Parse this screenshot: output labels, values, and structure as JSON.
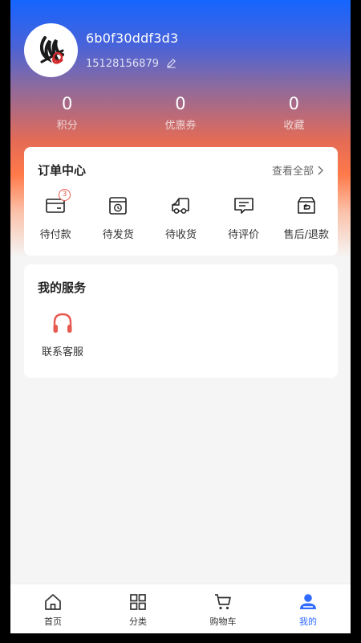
{
  "profile": {
    "username": "6b0f30ddf3d3",
    "phone": "15128156879"
  },
  "stats": [
    {
      "value": "0",
      "label": "积分"
    },
    {
      "value": "0",
      "label": "优惠券"
    },
    {
      "value": "0",
      "label": "收藏"
    }
  ],
  "orders": {
    "title": "订单中心",
    "view_all": "查看全部",
    "items": [
      {
        "label": "待付款",
        "icon": "wallet-icon",
        "badge": "3"
      },
      {
        "label": "待发货",
        "icon": "package-icon"
      },
      {
        "label": "待收货",
        "icon": "truck-icon"
      },
      {
        "label": "待评价",
        "icon": "comment-icon"
      },
      {
        "label": "售后/退款",
        "icon": "refund-icon"
      }
    ]
  },
  "services": {
    "title": "我的服务",
    "items": [
      {
        "label": "联系客服",
        "icon": "headset-icon"
      }
    ]
  },
  "tabbar": {
    "items": [
      {
        "label": "首页",
        "icon": "home-icon"
      },
      {
        "label": "分类",
        "icon": "grid-icon"
      },
      {
        "label": "购物车",
        "icon": "cart-icon"
      },
      {
        "label": "我的",
        "icon": "user-icon",
        "active": true
      }
    ]
  },
  "colors": {
    "accent": "#2f6bff",
    "badge": "#e85a4f",
    "service_icon": "#e85a4f"
  }
}
